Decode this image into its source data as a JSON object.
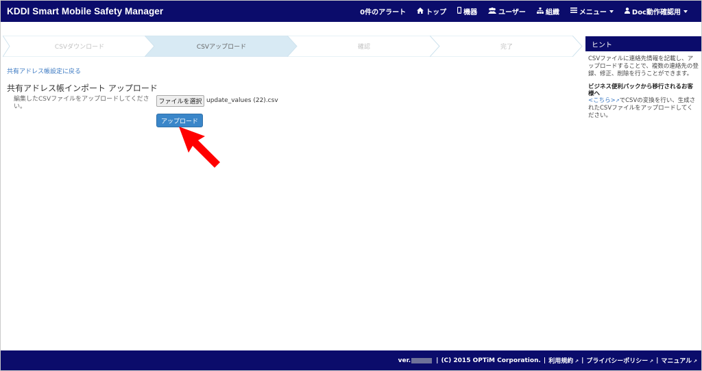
{
  "navbar": {
    "brand": "KDDI Smart Mobile Safety Manager",
    "alerts": "0件のアラート",
    "top": "トップ",
    "devices": "機器",
    "users": "ユーザー",
    "org": "組織",
    "menu": "メニュー",
    "account": "Doc動作確認用"
  },
  "steps": [
    {
      "label": "CSVダウンロード",
      "state": "done"
    },
    {
      "label": "CSVアップロード",
      "state": "active"
    },
    {
      "label": "確認",
      "state": "todo"
    },
    {
      "label": "完了",
      "state": "todo"
    }
  ],
  "main": {
    "back_link": "共有アドレス帳設定に戻る",
    "title": "共有アドレス帳インポート アップロード",
    "description": "編集したCSVファイルをアップロードしてください。",
    "file_button": "ファイルを選択",
    "file_name": "update_values (22).csv",
    "upload_button": "アップロード"
  },
  "hint": {
    "title": "ヒント",
    "text1": "CSVファイルに連絡先情報を記載し、アップロードすることで、複数の連絡先の登録、修正、削除を行うことができます。",
    "sub_title": "ビジネス便利パックから移行されるお客様へ",
    "link": "<こちら>",
    "text2": "でCSVの変換を行い、生成されたCSVファイルをアップロードしてください。"
  },
  "footer": {
    "ver_prefix": "ver.",
    "copyright": "(C) 2015 OPTiM Corporation.",
    "terms": "利用規約",
    "privacy": "プライバシーポリシー",
    "manual": "マニュアル"
  },
  "colors": {
    "navbar": "#0b0c6b",
    "step_active": "#d8eaf4",
    "primary_button": "#3a86c9",
    "link": "#3a78c2",
    "arrow": "#ff0000"
  },
  "icons": [
    "home-icon",
    "mobile-icon",
    "users-icon",
    "sitemap-icon",
    "list-icon",
    "user-icon",
    "external-link-icon"
  ]
}
